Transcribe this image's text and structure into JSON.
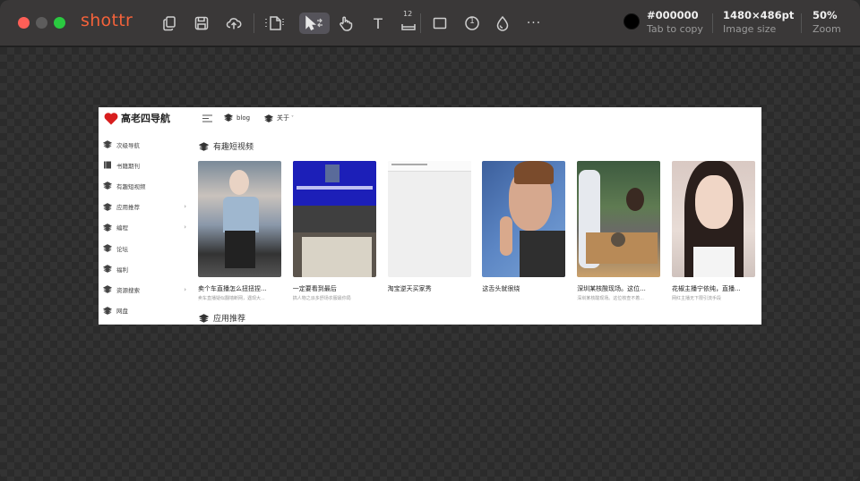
{
  "app": {
    "name": "shottr"
  },
  "toolbar": {
    "tools": [
      "copy-icon",
      "save-icon",
      "cloud-upload-icon",
      "crop-icon",
      "select-arrow-icon",
      "hand-pointer-icon",
      "text-icon",
      "ruler-icon",
      "rectangle-icon",
      "counter-icon",
      "blur-drop-icon",
      "more-icon"
    ],
    "text_tool": "T",
    "ruler_value": "12",
    "counter_value": "1",
    "more": "···"
  },
  "color": {
    "hex": "#000000",
    "hint": "Tab to copy"
  },
  "image_size": {
    "value": "1480×486pt",
    "label": "Image size"
  },
  "zoom": {
    "value": "50%",
    "label": "Zoom"
  },
  "screenshot": {
    "site_title": "高老四导航",
    "nav": [
      {
        "label": "blog"
      },
      {
        "label": "关于"
      }
    ],
    "nav_dropdown": "˅",
    "sidebar": [
      {
        "label": "次级导航",
        "chevron": ""
      },
      {
        "label": "书籍期刊",
        "chevron": ""
      },
      {
        "label": "有趣短视频",
        "chevron": ""
      },
      {
        "label": "应用推荐",
        "chevron": "›"
      },
      {
        "label": "编程",
        "chevron": "›"
      },
      {
        "label": "论坛",
        "chevron": ""
      },
      {
        "label": "福利",
        "chevron": ""
      },
      {
        "label": "资源搜索",
        "chevron": "›"
      },
      {
        "label": "网盘",
        "chevron": ""
      }
    ],
    "section1": "有趣短视频",
    "section2": "应用推荐",
    "cards": [
      {
        "title": "卖个车直播怎么扭扭捏...",
        "desc": "卖车直播疑似翻墙断网，遇现大..."
      },
      {
        "title": "一定要看到最后",
        "desc": "搞人物之派多舒场衣服最你局"
      },
      {
        "title": "淘宝逆天买家秀",
        "desc": ""
      },
      {
        "title": "这舌头就很绕",
        "desc": ""
      },
      {
        "title": "深圳某核酸现场。这位...",
        "desc": "深圳某核酸现场。这位核查不着..."
      },
      {
        "title": "花椒主播宁依纯，直播...",
        "desc": "网红主播无下限引流手段"
      }
    ]
  }
}
